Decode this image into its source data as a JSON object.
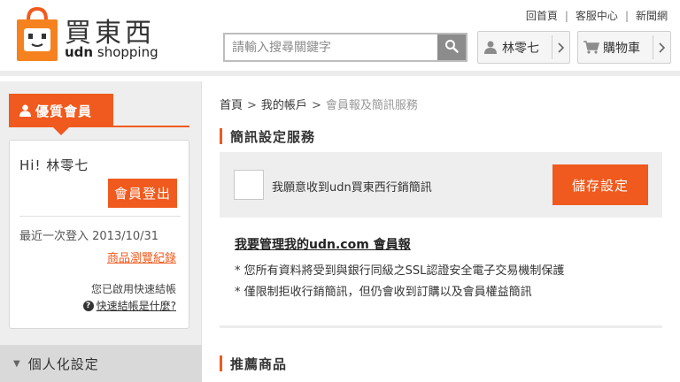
{
  "brand": {
    "logo_text_cn": "買東西",
    "logo_text_en_bold": "udn",
    "logo_text_en": " shopping"
  },
  "top_links": [
    "回首頁",
    "客服中心",
    "新聞網"
  ],
  "search": {
    "placeholder": "請輸入搜尋關鍵字",
    "value": ""
  },
  "header_buttons": {
    "user_name": "林零七",
    "cart_label": "購物車"
  },
  "sidebar": {
    "vip_tab": "優質會員",
    "greeting": "Hi! 林零七",
    "logout_label": "會員登出",
    "last_login": "最近一次登入 2013/10/31",
    "browse_history": "商品瀏覽紀錄",
    "quick_enabled": "您已啟用快速結帳",
    "quick_what": "快速結帳是什麼?",
    "personal_settings": "個人化設定"
  },
  "breadcrumb": {
    "items": [
      "首頁",
      "我的帳戶",
      "會員報及簡訊服務"
    ]
  },
  "main": {
    "sms_title": "簡訊設定服務",
    "sms_checkbox_label": "我願意收到udn買東西行銷簡訊",
    "sms_checked": false,
    "save_label": "儲存設定",
    "manage_link": "我要管理我的udn.com 會員報",
    "notes": [
      "* 您所有資料將受到與銀行同級之SSL認證安全電子交易機制保護",
      "* 僅限制拒收行銷簡訊，但仍會收到訂購以及會員權益簡訊"
    ],
    "recommend_title": "推薦商品"
  },
  "colors": {
    "accent": "#f05a1e",
    "sidebar_bg": "#eeeeee",
    "header_border": "#ececec"
  },
  "icons": [
    "shopping-bag-logo-icon",
    "search-icon",
    "user-icon",
    "cart-icon",
    "chevron-right-icon",
    "question-icon",
    "triangle-down-icon"
  ]
}
